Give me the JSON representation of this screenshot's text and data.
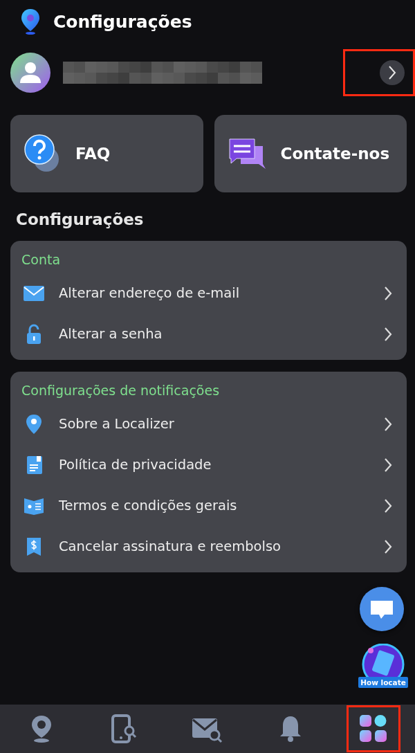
{
  "header": {
    "title": "Configurações"
  },
  "profile": {
    "highlighted": true
  },
  "quick_actions": [
    {
      "label": "FAQ"
    },
    {
      "label": "Contate-nos"
    }
  ],
  "section_title": "Configurações",
  "groups": [
    {
      "title": "Conta",
      "items": [
        {
          "label": "Alterar endereço de e-mail"
        },
        {
          "label": "Alterar a senha"
        }
      ]
    },
    {
      "title": "Configurações de notificações",
      "items": [
        {
          "label": "Sobre a Localizer"
        },
        {
          "label": "Política de privacidade"
        },
        {
          "label": "Termos e condições gerais"
        },
        {
          "label": "Cancelar assinatura e reembolso"
        }
      ]
    }
  ],
  "badge": {
    "label": "How locate"
  },
  "bottom_nav": [
    {
      "highlighted": false
    },
    {
      "highlighted": false
    },
    {
      "highlighted": false
    },
    {
      "highlighted": false
    },
    {
      "highlighted": true
    }
  ]
}
